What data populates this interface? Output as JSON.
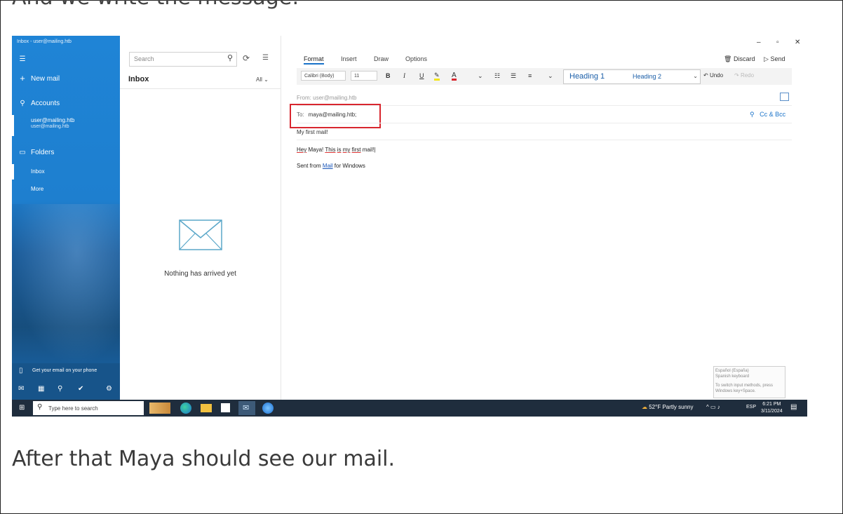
{
  "article": {
    "heading_fragment": "And we write the message:",
    "caption": "After that Maya should see our mail."
  },
  "nav": {
    "window_title": "Inbox - user@mailing.htb",
    "menu_icon": "hamburger-icon",
    "new_mail": "New mail",
    "accounts_label": "Accounts",
    "account_name": "user@mailing.htb",
    "account_email": "user@mailing.htb",
    "folders_label": "Folders",
    "inbox": "Inbox",
    "more": "More",
    "phone_promo": "Get your email on your phone"
  },
  "list": {
    "search_placeholder": "Search",
    "folder_title": "Inbox",
    "filter_label": "All",
    "empty_message": "Nothing has arrived yet"
  },
  "compose": {
    "tabs": [
      "Format",
      "Insert",
      "Draw",
      "Options"
    ],
    "active_tab": "Format",
    "discard": "Discard",
    "send": "Send",
    "font_name": "Calibri (Body)",
    "font_size": "11",
    "bold": "B",
    "italic": "I",
    "underline": "U",
    "font_color_letter": "A",
    "heading1": "Heading 1",
    "heading2": "Heading 2",
    "undo": "Undo",
    "redo": "Redo",
    "from_label": "From:",
    "from_value": "user@mailing.htb",
    "to_label": "To:",
    "to_value": "maya@mailing.htb;",
    "cc_bcc": "Cc & Bcc",
    "subject": "My first mail!",
    "body_words": [
      "Hey",
      " Maya! ",
      "This",
      " ",
      "is",
      " ",
      "my",
      " ",
      "first",
      " mail!"
    ],
    "signature_prefix": "Sent from ",
    "signature_link": "Mail",
    "signature_suffix": " for Windows",
    "ime_line1": "Español (España)",
    "ime_line2": "Spanish keyboard",
    "ime_line3": "To switch input methods, press",
    "ime_line4": "Windows key+Space."
  },
  "taskbar": {
    "search_placeholder": "Type here to search",
    "weather": "52°F  Partly sunny",
    "language": "ESP",
    "time": "6:21 PM",
    "date": "3/11/2024",
    "accent": "#1f2d3d"
  }
}
